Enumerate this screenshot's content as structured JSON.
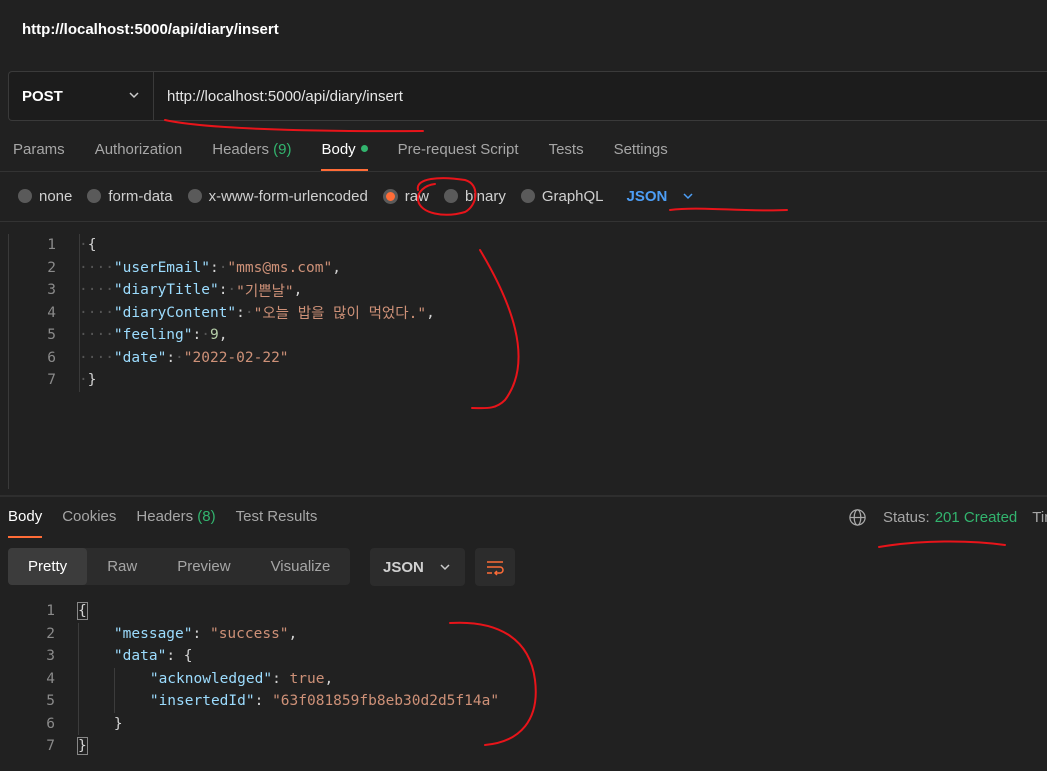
{
  "title": "http://localhost:5000/api/diary/insert",
  "request": {
    "method": "POST",
    "url": "http://localhost:5000/api/diary/insert",
    "tabs": [
      {
        "label": "Params",
        "count": ""
      },
      {
        "label": "Authorization",
        "count": ""
      },
      {
        "label": "Headers",
        "count": "(9)"
      },
      {
        "label": "Body",
        "count": ""
      },
      {
        "label": "Pre-request Script",
        "count": ""
      },
      {
        "label": "Tests",
        "count": ""
      },
      {
        "label": "Settings",
        "count": ""
      }
    ],
    "body_types": [
      "none",
      "form-data",
      "x-www-form-urlencoded",
      "raw",
      "binary",
      "GraphQL"
    ],
    "selected_body_type": "raw",
    "format": "JSON",
    "line_numbers": [
      "1",
      "2",
      "3",
      "4",
      "5",
      "6",
      "7"
    ],
    "body": {
      "open": "{",
      "close": "}",
      "k1": "\"userEmail\"",
      "v1": "\"mms@ms.com\"",
      "k2": "\"diaryTitle\"",
      "v2": "\"기쁜날\"",
      "k3": "\"diaryContent\"",
      "v3": "\"오늘 밥을 많이 먹었다.\"",
      "k4": "\"feeling\"",
      "v4": "9",
      "k5": "\"date\"",
      "v5": "\"2022-02-22\""
    }
  },
  "response": {
    "tabs": [
      {
        "label": "Body",
        "count": ""
      },
      {
        "label": "Cookies",
        "count": ""
      },
      {
        "label": "Headers",
        "count": "(8)"
      },
      {
        "label": "Test Results",
        "count": ""
      }
    ],
    "status_label": "Status:",
    "status_value": "201 Created",
    "time_label": "Tim",
    "views": [
      "Pretty",
      "Raw",
      "Preview",
      "Visualize"
    ],
    "format": "JSON",
    "line_numbers": [
      "1",
      "2",
      "3",
      "4",
      "5",
      "6",
      "7"
    ],
    "body": {
      "open": "{",
      "close": "}",
      "k_message": "\"message\"",
      "v_message": "\"success\"",
      "k_data": "\"data\"",
      "k_ack": "\"acknowledged\"",
      "v_ack": "true",
      "k_id": "\"insertedId\"",
      "v_id": "\"63f081859fb8eb30d2d5f14a\""
    }
  },
  "colors": {
    "accent": "#ff6c37",
    "success": "#32b46e",
    "link": "#4d9ef5",
    "annotation": "#e8141a"
  }
}
